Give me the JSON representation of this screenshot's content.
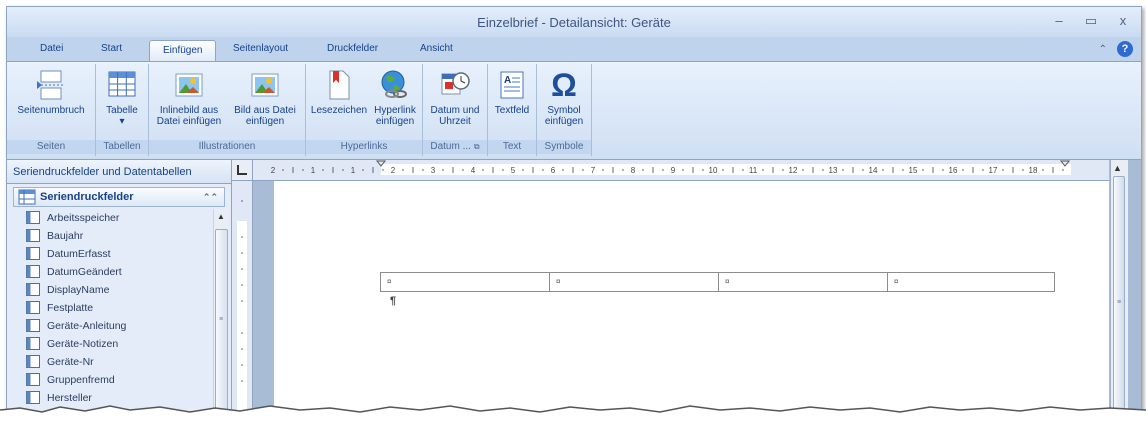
{
  "window": {
    "title": "Einzelbrief - Detailansicht: Geräte",
    "minimize": "–",
    "maximize": "▭",
    "close": "x"
  },
  "tabs": [
    "Datei",
    "Start",
    "Einfügen",
    "Seitenlayout",
    "Druckfelder",
    "Ansicht"
  ],
  "active_tab": "Einfügen",
  "ribbon": {
    "groups": [
      {
        "label": "Seiten"
      },
      {
        "label": "Tabellen"
      },
      {
        "label": "Illustrationen"
      },
      {
        "label": "Hyperlinks"
      },
      {
        "label": "Datum ..."
      },
      {
        "label": "Text"
      },
      {
        "label": "Symbole"
      }
    ],
    "buttons": {
      "seitenumbruch": "Seitenumbruch",
      "tabelle": "Tabelle",
      "tabelle_arrow": "▾",
      "inline_bild_1": "Inlinebild aus",
      "inline_bild_2": "Datei einfügen",
      "bild_aus_datei_1": "Bild aus Datei",
      "bild_aus_datei_2": "einfügen",
      "lesezeichen": "Lesezeichen",
      "hyperlink_1": "Hyperlink",
      "hyperlink_2": "einfügen",
      "datum_1": "Datum und",
      "datum_2": "Uhrzeit",
      "textfeld": "Textfeld",
      "symbol_1": "Symbol",
      "symbol_2": "einfügen",
      "symbol_glyph": "Ω"
    }
  },
  "left_panel": {
    "header": "Seriendruckfelder und Datentabellen",
    "section_title": "Seriendruckfelder",
    "collapse_glyph": "⌃⌃",
    "fields": [
      "Arbeitsspeicher",
      "Baujahr",
      "DatumErfasst",
      "DatumGeändert",
      "DisplayName",
      "Festplatte",
      "Geräte-Anleitung",
      "Geräte-Notizen",
      "Geräte-Nr",
      "Gruppenfremd",
      "Hersteller"
    ]
  },
  "document": {
    "table_cell_mark": "¤",
    "paragraph_mark": "¶",
    "ruler_numbers": [
      "2",
      "1",
      "1",
      "2",
      "3",
      "4",
      "5",
      "6",
      "7",
      "8",
      "9",
      "10",
      "11",
      "12",
      "13",
      "14",
      "15",
      "16",
      "17",
      "18"
    ]
  },
  "colors": {
    "ribbon_bg": "#cfdff3",
    "accent_blue": "#15428b",
    "window_border": "#8ea4c1"
  }
}
